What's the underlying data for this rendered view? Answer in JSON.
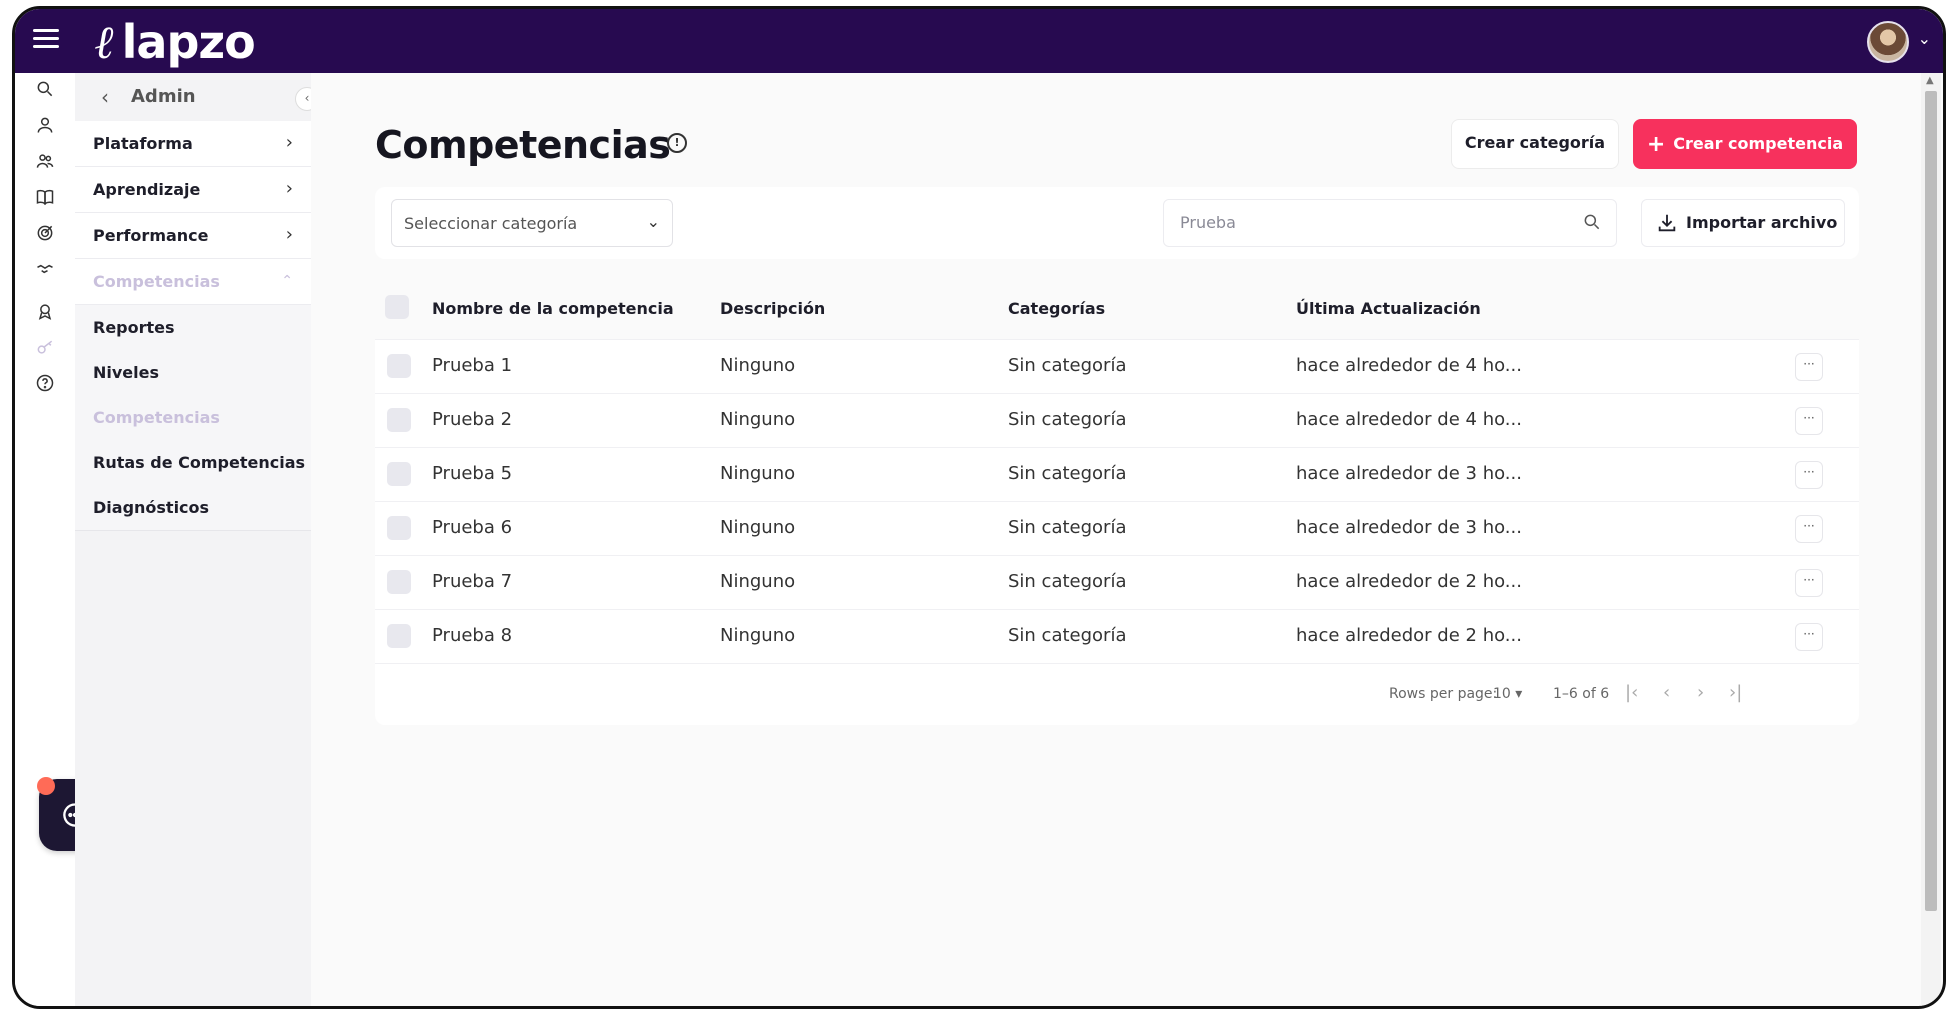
{
  "app": {
    "logo": "lapzo"
  },
  "sidebar": {
    "header": "Admin",
    "items": [
      {
        "label": "Plataforma"
      },
      {
        "label": "Aprendizaje"
      },
      {
        "label": "Performance"
      },
      {
        "label": "Competencias"
      }
    ],
    "subitems": [
      {
        "label": "Reportes"
      },
      {
        "label": "Niveles"
      },
      {
        "label": "Competencias"
      },
      {
        "label": "Rutas de Competencias"
      },
      {
        "label": "Diagnósticos"
      }
    ]
  },
  "page": {
    "title": "Competencias",
    "create_category_label": "Crear categoría",
    "create_competency_label": "Crear competencia"
  },
  "filters": {
    "category_select": "Seleccionar categoría",
    "search_placeholder": "Prueba",
    "import_label": "Importar archivo"
  },
  "table": {
    "columns": [
      "Nombre de la competencia",
      "Descripción",
      "Categorías",
      "Última Actualización"
    ],
    "rows": [
      {
        "name": "Prueba 1",
        "description": "Ninguno",
        "category": "Sin categoría",
        "updated": "hace alrededor de 4 ho..."
      },
      {
        "name": "Prueba 2",
        "description": "Ninguno",
        "category": "Sin categoría",
        "updated": "hace alrededor de 4 ho..."
      },
      {
        "name": "Prueba 5",
        "description": "Ninguno",
        "category": "Sin categoría",
        "updated": "hace alrededor de 3 ho..."
      },
      {
        "name": "Prueba 6",
        "description": "Ninguno",
        "category": "Sin categoría",
        "updated": "hace alrededor de 3 ho..."
      },
      {
        "name": "Prueba 7",
        "description": "Ninguno",
        "category": "Sin categoría",
        "updated": "hace alrededor de 2 ho..."
      },
      {
        "name": "Prueba 8",
        "description": "Ninguno",
        "category": "Sin categoría",
        "updated": "hace alrededor de 2 ho..."
      }
    ]
  },
  "pagination": {
    "rows_per_page_label": "Rows per page:",
    "rows_per_page_value": "10",
    "range": "1–6 of 6"
  },
  "icons": {
    "rail": [
      "search-icon",
      "user-icon",
      "users-icon",
      "book-icon",
      "target-icon",
      "handshake-icon",
      "medal-icon",
      "key-icon",
      "help-icon"
    ]
  },
  "colors": {
    "topbar": "#270a50",
    "primary_button": "#f7315d",
    "chat_button": "#1d1733",
    "notification_dot": "#ff6b57"
  }
}
